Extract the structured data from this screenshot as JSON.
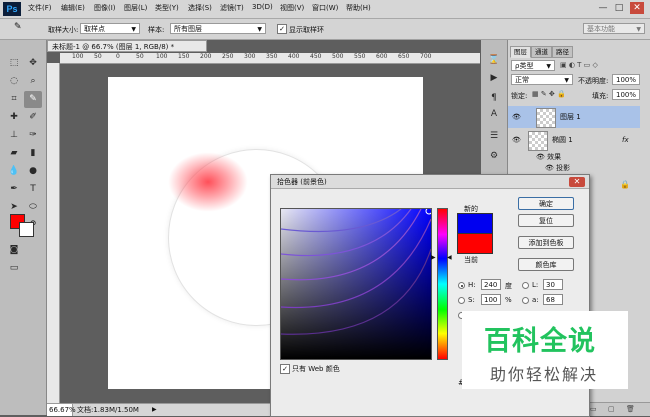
{
  "app": {
    "logo": "Ps"
  },
  "menu": [
    "文件(F)",
    "编辑(E)",
    "图像(I)",
    "图层(L)",
    "类型(Y)",
    "选择(S)",
    "滤镜(T)",
    "3D(D)",
    "视图(V)",
    "窗口(W)",
    "帮助(H)"
  ],
  "window_controls": {
    "minimize": "—",
    "maximize": "□",
    "close": "✕"
  },
  "options_bar": {
    "sample_size_label": "取样大小:",
    "sample_size_value": "取样点",
    "sample_label": "样本:",
    "sample_value": "所有图层",
    "show_ring_label": "显示取样环",
    "show_ring_checked": true,
    "workspace": "基本功能"
  },
  "document": {
    "tab_title": "未标题-1 @ 66.7% (图层 1, RGB/8) *",
    "ruler_labels": [
      "100",
      "50",
      "0",
      "50",
      "100",
      "150",
      "200",
      "250",
      "300",
      "350",
      "400",
      "450",
      "500",
      "550",
      "600",
      "650",
      "700"
    ]
  },
  "status": {
    "zoom": "66.67%",
    "doc_info": "文档:1.83M/1.50M"
  },
  "layers_panel": {
    "tabs": [
      "图层",
      "通道",
      "路径"
    ],
    "filter_label": "ρ类型",
    "blend_mode": "正常",
    "opacity_label": "不透明度:",
    "opacity_value": "100%",
    "lock_label": "锁定:",
    "fill_label": "填充:",
    "fill_value": "100%",
    "layers": [
      {
        "name": "图层 1",
        "selected": true
      },
      {
        "name": "椭圆 1",
        "selected": false,
        "fx": "fx"
      }
    ],
    "effects_label": "效果",
    "effect_item": "投影"
  },
  "color_picker": {
    "title": "拾色器 (前景色)",
    "new_label": "新的",
    "current_label": "当前",
    "new_color": "#0000f0",
    "current_color": "#ff0000",
    "buttons": {
      "ok": "确定",
      "reset": "复位",
      "add_swatch": "添加到色板",
      "libraries": "颜色库"
    },
    "hsb": {
      "h": {
        "label": "H:",
        "value": "240",
        "unit": "度"
      },
      "s": {
        "label": "S:",
        "value": "100",
        "unit": "%"
      }
    },
    "lab": {
      "l": {
        "label": "L:",
        "value": "30"
      },
      "a": {
        "label": "a:",
        "value": "68"
      }
    },
    "web_only_label": "只有 Web 颜色",
    "web_only_checked": true
  },
  "watermark": {
    "title": "百科全说",
    "subtitle": "助你轻松解决"
  },
  "colors": {
    "accent_selection": "#a9c2e8",
    "foreground": "#ff0000",
    "background": "#ffffff"
  }
}
